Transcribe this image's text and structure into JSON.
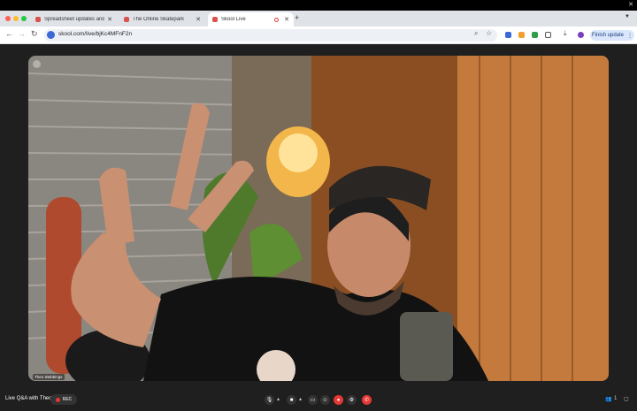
{
  "tabs": [
    {
      "title": "Spreadsheet updates and a…",
      "favicon_color": "#d9534f",
      "active": false
    },
    {
      "title": "The Online Skatepark",
      "favicon_color": "#d9534f",
      "active": false
    },
    {
      "title": "Skool Live",
      "favicon_color": "#d9534f",
      "active": true
    }
  ],
  "toolbar": {
    "url": "skool.com/live/bjKc4MFnF2n",
    "finish_update_label": "Finish update",
    "back_icon": "arrow-left",
    "forward_icon": "arrow-right",
    "reload_icon": "reload"
  },
  "video": {
    "participant_name": "Theo Stebbings"
  },
  "bottom_bar": {
    "title": "Live Q&A with Theo",
    "rec_label": "REC",
    "participant_count": "1",
    "colors": {
      "record_red": "#e53935",
      "control_bg": "#333333"
    }
  }
}
